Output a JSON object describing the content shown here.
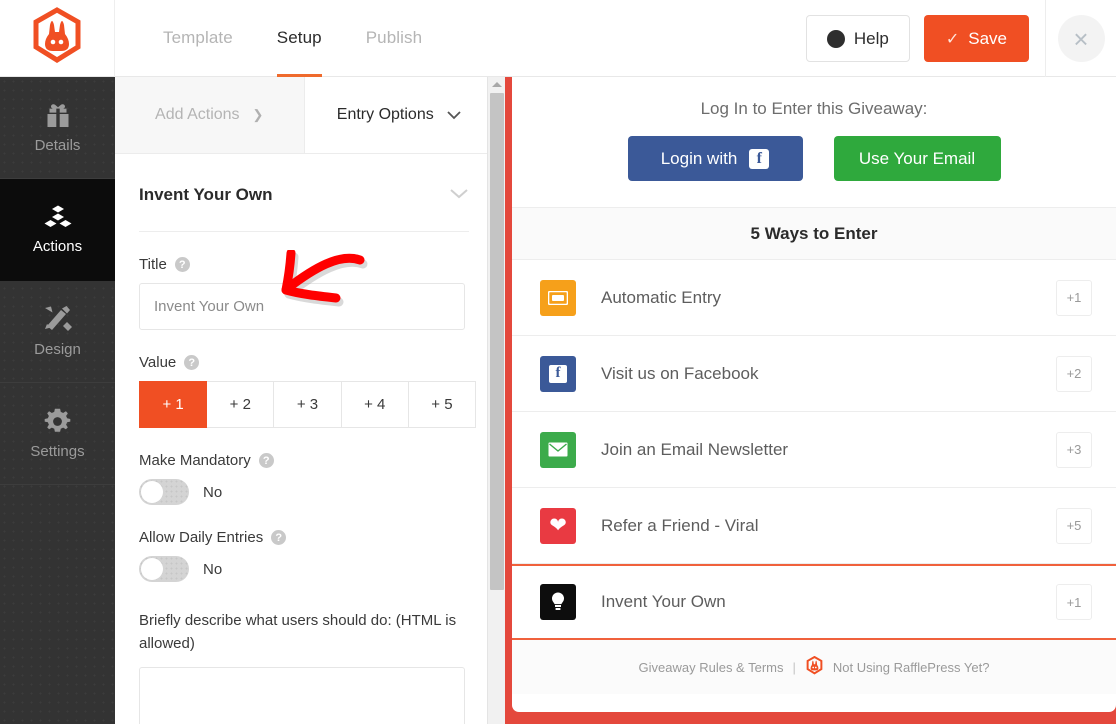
{
  "brand": {
    "logo_icon": "rafflepress-rabbit-logo",
    "accent": "#f04f23",
    "red": "#e4483c"
  },
  "topbar": {
    "tabs": [
      {
        "label": "Template",
        "active": false
      },
      {
        "label": "Setup",
        "active": true
      },
      {
        "label": "Publish",
        "active": false
      }
    ],
    "help_label": "Help",
    "help_icon": "question-mark-icon",
    "save_label": "Save",
    "save_icon": "check-icon",
    "close_icon": "close-icon",
    "close_glyph": "×"
  },
  "rail": {
    "items": [
      {
        "label": "Details",
        "icon": "gift-icon",
        "active": false
      },
      {
        "label": "Actions",
        "icon": "blocks-icon",
        "active": true
      },
      {
        "label": "Design",
        "icon": "pencil-ruler-icon",
        "active": false
      },
      {
        "label": "Settings",
        "icon": "gear-icon",
        "active": false
      }
    ]
  },
  "panel": {
    "subtabs": [
      {
        "label": "Add Actions",
        "icon": "chevron-right-icon",
        "glyph": "❯",
        "active": false
      },
      {
        "label": "Entry Options",
        "icon": "chevron-down-icon",
        "glyph": "⌄",
        "active": true
      }
    ],
    "section_title": "Invent Your Own",
    "section_chevron": "chevron-down-icon",
    "section_chevron_glyph": "⌄",
    "help_glyph": "?",
    "title_field": {
      "label": "Title",
      "value": "",
      "placeholder": "Invent Your Own"
    },
    "value_field": {
      "label": "Value",
      "options": [
        "+ 1",
        "+ 2",
        "+ 3",
        "+ 4",
        "+ 5"
      ],
      "selected_index": 0
    },
    "mandatory_field": {
      "label": "Make Mandatory",
      "state": "No",
      "on": false
    },
    "daily_field": {
      "label": "Allow Daily Entries",
      "state": "No",
      "on": false
    },
    "description_field": {
      "label": "Briefly describe what users should do: (HTML is allowed)",
      "value": "",
      "placeholder": ""
    }
  },
  "preview": {
    "login_title": "Log In to Enter this Giveaway:",
    "facebook_label": "Login with",
    "facebook_icon": "facebook-icon",
    "facebook_glyph": "f",
    "facebook_color": "#3b5998",
    "email_label": "Use Your Email",
    "email_color": "#2fa93d",
    "ways_title": "5 Ways to Enter",
    "entries": [
      {
        "label": "Automatic Entry",
        "badge": "+1",
        "icon": "ticket-icon",
        "glyph": "▣",
        "color": "#f6a01a",
        "highlight": false
      },
      {
        "label": "Visit us on Facebook",
        "badge": "+2",
        "icon": "facebook-icon",
        "glyph": "f",
        "color": "#3b5998",
        "highlight": false
      },
      {
        "label": "Join an Email Newsletter",
        "badge": "+3",
        "icon": "envelope-icon",
        "glyph": "✉",
        "color": "#3cab4b",
        "highlight": false
      },
      {
        "label": "Refer a Friend - Viral",
        "badge": "+5",
        "icon": "heart-icon",
        "glyph": "♥",
        "color": "#e93a42",
        "highlight": false
      },
      {
        "label": "Invent Your Own",
        "badge": "+1",
        "icon": "lightbulb-icon",
        "glyph": "Ὂ1",
        "color": "#0d0d0d",
        "highlight": true
      }
    ],
    "footer": {
      "rules_label": "Giveaway Rules & Terms",
      "separator": "|",
      "logo_icon": "rafflepress-rabbit-logo",
      "promo_label": "Not Using RafflePress Yet?"
    }
  },
  "annotation": {
    "icon": "red-arrow-annotation",
    "color": "#ff0000"
  }
}
